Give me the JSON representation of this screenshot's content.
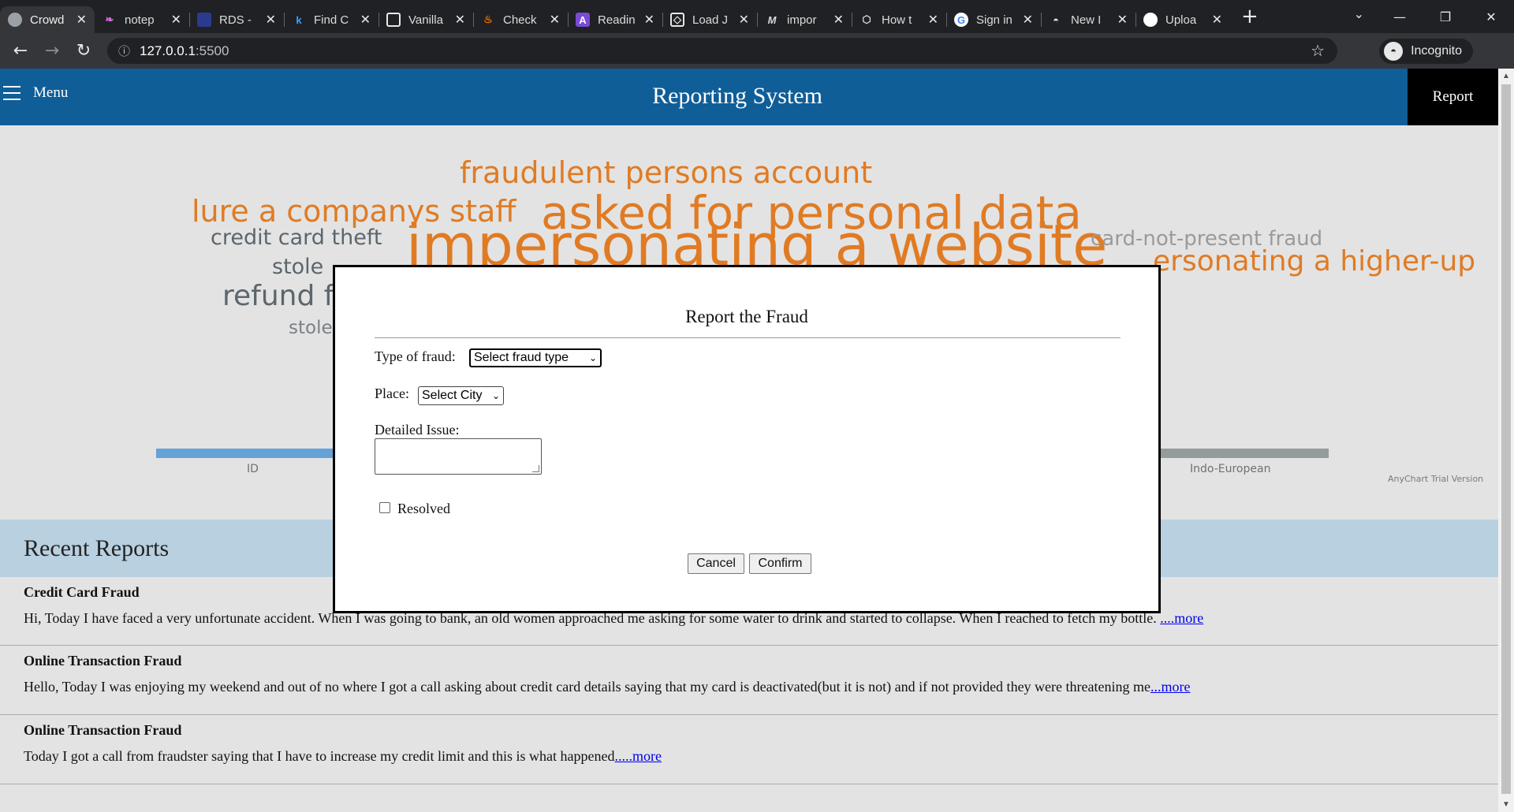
{
  "browser": {
    "tabs": [
      {
        "label": "Crowd",
        "icon": "globe-icon",
        "active": true
      },
      {
        "label": "notep",
        "icon": "notepad-icon"
      },
      {
        "label": "RDS -",
        "icon": "rds-icon"
      },
      {
        "label": "Find C",
        "icon": "k-icon"
      },
      {
        "label": "Vanilla",
        "icon": "square-icon"
      },
      {
        "label": "Check",
        "icon": "java-icon"
      },
      {
        "label": "Readin",
        "icon": "a-icon"
      },
      {
        "label": "Load J",
        "icon": "codepen-icon"
      },
      {
        "label": "impor",
        "icon": "medium-icon"
      },
      {
        "label": "How t",
        "icon": "cube-icon"
      },
      {
        "label": "Sign in",
        "icon": "google-icon"
      },
      {
        "label": "New I",
        "icon": "incognito-icon"
      },
      {
        "label": "Uploa",
        "icon": "github-icon"
      }
    ],
    "address": {
      "host": "127.0.0.1",
      "port": ":5500"
    },
    "incognito_label": "Incognito"
  },
  "header": {
    "menu_label": "Menu",
    "title": "Reporting System",
    "report_label": "Report"
  },
  "word_cloud": [
    {
      "text": "fraudulent persons account",
      "color": "#e07b24"
    },
    {
      "text": "lure a companys staff",
      "color": "#e07b24"
    },
    {
      "text": "asked for personal data",
      "color": "#e07b24"
    },
    {
      "text": "credit card theft",
      "color": "#5b666d"
    },
    {
      "text": "impersonating a website",
      "color": "#e07b24"
    },
    {
      "text": "card-not-present fraud",
      "color": "#9a9a9a"
    },
    {
      "text": "ersonating a higher-up",
      "color": "#e07b24"
    },
    {
      "text": "stole",
      "color": "#5b666d"
    },
    {
      "text": "refund f",
      "color": "#5b666d"
    },
    {
      "text": "stole",
      "color": "#7a8084"
    }
  ],
  "cloud_axis": {
    "left_label": "ID",
    "right_label": "Indo-European",
    "left_color": "#64a2d8",
    "right_color": "#949b9b"
  },
  "anychart_label": "AnyChart Trial Version",
  "recent": {
    "heading": "Recent Reports",
    "items": [
      {
        "title": "Credit Card Fraud",
        "body": "Hi, Today I have faced a very unfortunate accident. When I was going to bank, an old women approached me asking for some water to drink and started to collapse. When I reached to fetch my bottle. ",
        "more": "....more"
      },
      {
        "title": "Online Transaction Fraud",
        "body": "Hello, Today I was enjoying my weekend and out of no where I got a call asking about credit card details saying that my card is deactivated(but it is not) and if not provided they were threatening me",
        "more": "...more"
      },
      {
        "title": "Online Transaction Fraud",
        "body": "Today I got a call from fraudster saying that I have to increase my credit limit and this is what happened",
        "more": ".....more"
      }
    ]
  },
  "modal": {
    "title": "Report the Fraud",
    "type_label": "Type of fraud:",
    "type_value": "Select fraud type",
    "place_label": "Place:",
    "place_value": "Select City",
    "issue_label": "Detailed Issue:",
    "issue_value": "",
    "resolved_label": "Resolved",
    "resolved_checked": false,
    "cancel_label": "Cancel",
    "confirm_label": "Confirm"
  }
}
